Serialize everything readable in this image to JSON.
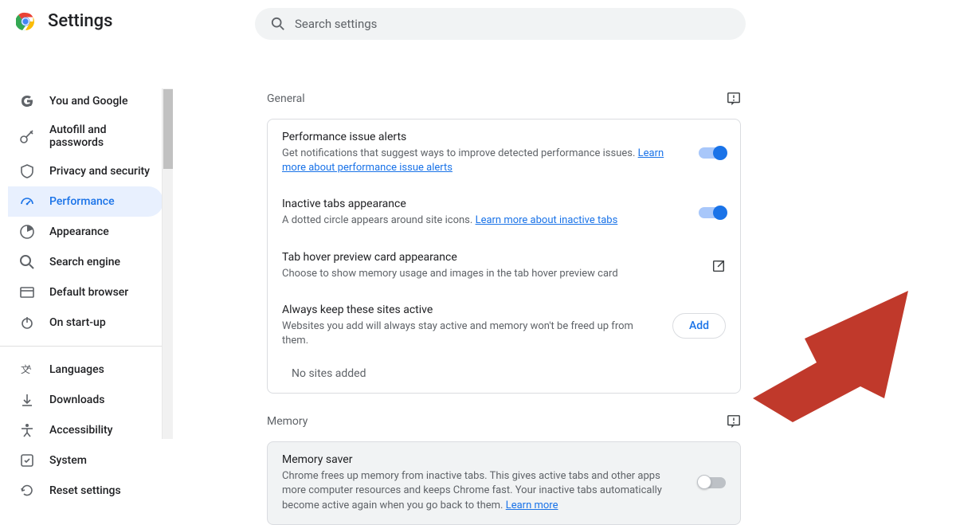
{
  "app_title": "Settings",
  "search": {
    "placeholder": "Search settings"
  },
  "sidebar": {
    "groups": [
      [
        {
          "icon": "g-icon",
          "label": "You and Google"
        },
        {
          "icon": "key-icon",
          "label": "Autofill and passwords"
        },
        {
          "icon": "shield-icon",
          "label": "Privacy and security"
        },
        {
          "icon": "speedometer-icon",
          "label": "Performance",
          "active": true
        },
        {
          "icon": "paint-icon",
          "label": "Appearance"
        },
        {
          "icon": "search-icon",
          "label": "Search engine"
        },
        {
          "icon": "browser-icon",
          "label": "Default browser"
        },
        {
          "icon": "power-icon",
          "label": "On start-up"
        }
      ],
      [
        {
          "icon": "translate-icon",
          "label": "Languages"
        },
        {
          "icon": "download-icon",
          "label": "Downloads"
        },
        {
          "icon": "accessibility-icon",
          "label": "Accessibility"
        },
        {
          "icon": "system-icon",
          "label": "System"
        },
        {
          "icon": "reset-icon",
          "label": "Reset settings"
        }
      ]
    ]
  },
  "sections": {
    "general": {
      "title": "General",
      "items": [
        {
          "title": "Performance issue alerts",
          "desc": "Get notifications that suggest ways to improve detected performance issues.",
          "link": "Learn more about performance issue alerts",
          "control": "toggle-on"
        },
        {
          "title": "Inactive tabs appearance",
          "desc": "A dotted circle appears around site icons.",
          "link": "Learn more about inactive tabs",
          "control": "toggle-on"
        },
        {
          "title": "Tab hover preview card appearance",
          "desc": "Choose to show memory usage and images in the tab hover preview card",
          "control": "external"
        },
        {
          "title": "Always keep these sites active",
          "desc": "Websites you add will always stay active and memory won't be freed up from them.",
          "control": "add-button",
          "button_label": "Add"
        }
      ],
      "empty_text": "No sites added"
    },
    "memory": {
      "title": "Memory",
      "items": [
        {
          "title": "Memory saver",
          "desc": "Chrome frees up memory from inactive tabs. This gives active tabs and other apps more computer resources and keeps Chrome fast. Your inactive tabs automatically become active again when you go back to them.",
          "link": "Learn more",
          "control": "toggle-off"
        }
      ]
    }
  },
  "colors": {
    "accent": "#1a73e8",
    "arrow": "#c0392b"
  }
}
